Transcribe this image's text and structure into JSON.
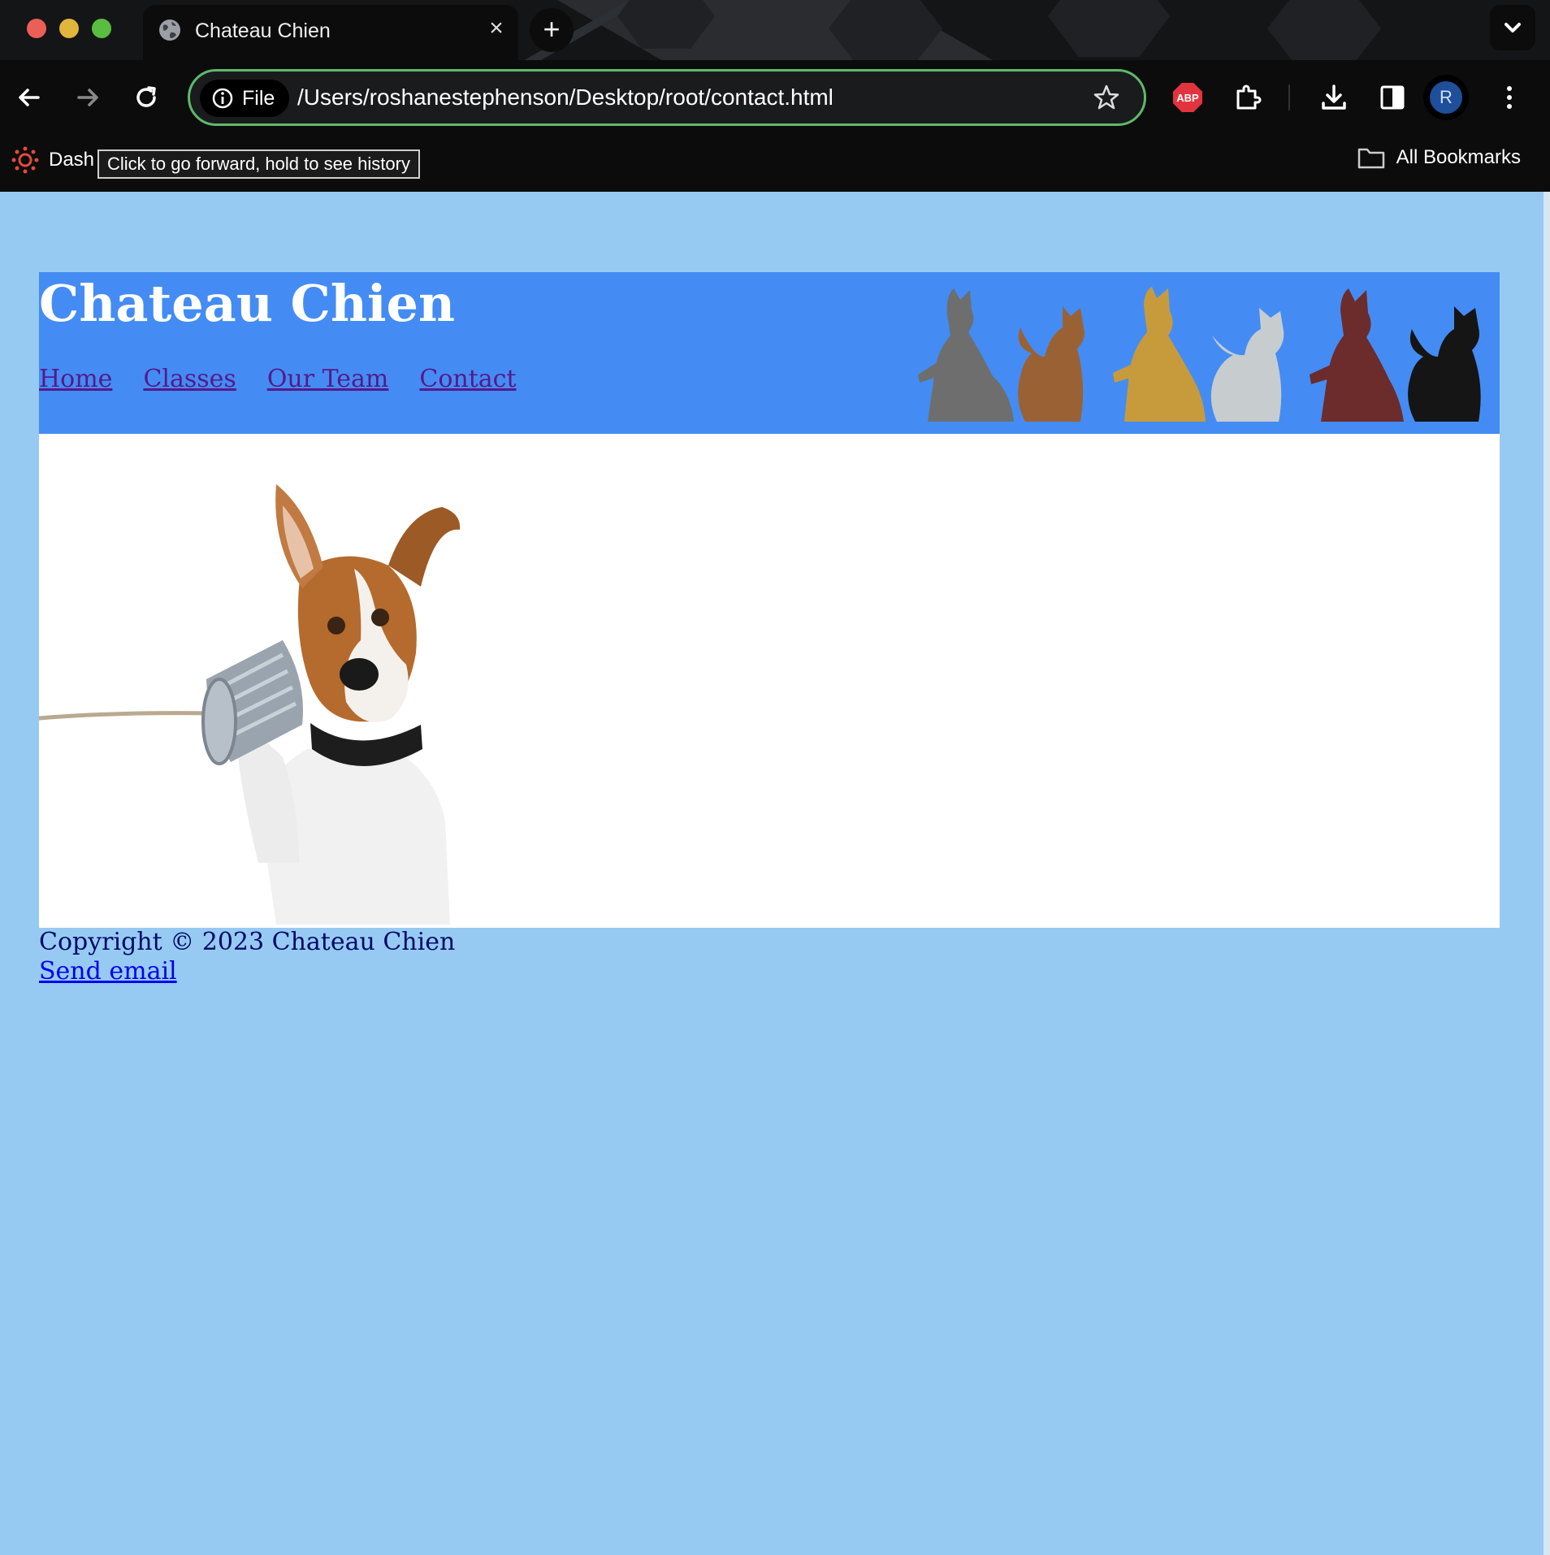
{
  "browser": {
    "tab_title": "Chateau Chien",
    "new_tab_label": "+",
    "address_chip": "File",
    "url": "/Users/roshanestephenson/Desktop/root/contact.html",
    "extension_abp": "ABP",
    "profile_initial": "R",
    "bookmark_dash": "Dash",
    "tooltip": "Click to go forward, hold to see history",
    "all_bookmarks": "All Bookmarks"
  },
  "site": {
    "title": "Chateau Chien",
    "nav": [
      "Home",
      "Classes",
      "Our Team",
      "Contact"
    ],
    "footer_copyright": "Copyright © 2023 Chateau Chien",
    "footer_email_link": "Send email"
  },
  "colors": {
    "page_bg": "#97CAF3",
    "header_bg": "#448CF3",
    "visited_link": "#551a8b",
    "link": "#0000ee",
    "omnibox_border": "#5fb96b"
  },
  "icons": [
    "globe-icon",
    "close-icon",
    "back-icon",
    "forward-icon",
    "reload-icon",
    "info-icon",
    "bookmark-star-icon",
    "extensions-icon",
    "download-icon",
    "side-panel-icon",
    "more-menu-icon",
    "folder-icon",
    "tab-search-chevron-icon"
  ]
}
